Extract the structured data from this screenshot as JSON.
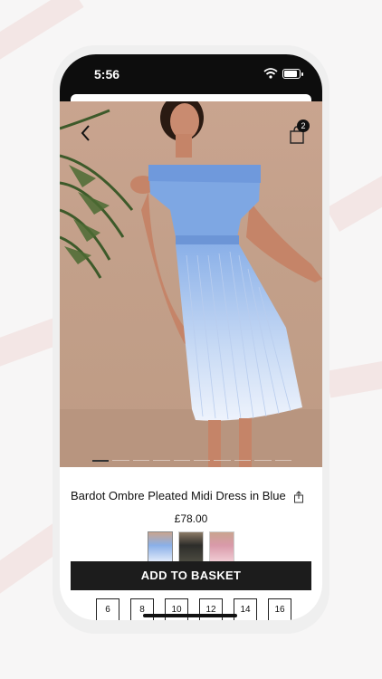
{
  "status": {
    "time": "5:56"
  },
  "header": {
    "cart_count": "2"
  },
  "product": {
    "title": "Bardot Ombre Pleated Midi Dress in Blue",
    "price": "£78.00",
    "add_label": "ADD TO BASKET",
    "sizes": [
      "6",
      "8",
      "10",
      "12",
      "14",
      "16"
    ]
  },
  "icons": [
    "back-arrow-icon",
    "shopping-bag-icon",
    "share-icon",
    "wifi-icon",
    "battery-icon"
  ],
  "colors": {
    "accent": "#1c1c1c",
    "dress": "#8ab0e8",
    "background": "#c9a48f"
  }
}
